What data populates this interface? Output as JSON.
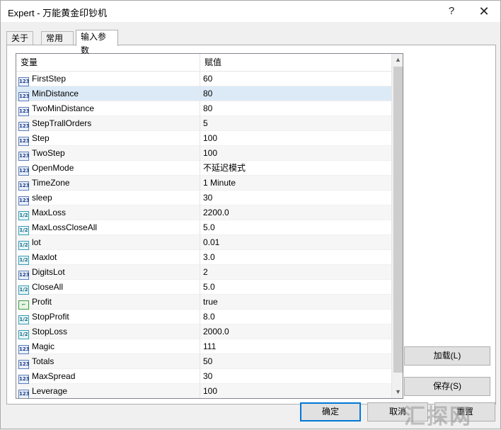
{
  "window": {
    "title": "Expert - 万能黄金印钞机",
    "help": "?",
    "close": "✕"
  },
  "tabs": [
    {
      "label": "关于"
    },
    {
      "label": "常用"
    },
    {
      "label": "输入参数"
    }
  ],
  "grid": {
    "col_variable": "变量",
    "col_value": "赋值",
    "rows": [
      {
        "name": "FirstStep",
        "value": "60",
        "type": "int"
      },
      {
        "name": "MinDistance",
        "value": "80",
        "type": "int"
      },
      {
        "name": "TwoMinDistance",
        "value": "80",
        "type": "int"
      },
      {
        "name": "StepTrallOrders",
        "value": "5",
        "type": "int"
      },
      {
        "name": "Step",
        "value": "100",
        "type": "int"
      },
      {
        "name": "TwoStep",
        "value": "100",
        "type": "int"
      },
      {
        "name": "OpenMode",
        "value": "不延迟模式",
        "type": "int"
      },
      {
        "name": "TimeZone",
        "value": "1 Minute",
        "type": "int"
      },
      {
        "name": "sleep",
        "value": "30",
        "type": "int"
      },
      {
        "name": "MaxLoss",
        "value": "2200.0",
        "type": "double"
      },
      {
        "name": "MaxLossCloseAll",
        "value": "5.0",
        "type": "double"
      },
      {
        "name": "lot",
        "value": "0.01",
        "type": "double"
      },
      {
        "name": "Maxlot",
        "value": "3.0",
        "type": "double"
      },
      {
        "name": "DigitsLot",
        "value": "2",
        "type": "int"
      },
      {
        "name": "CloseAll",
        "value": "5.0",
        "type": "double"
      },
      {
        "name": "Profit",
        "value": "true",
        "type": "bool"
      },
      {
        "name": "StopProfit",
        "value": "8.0",
        "type": "double"
      },
      {
        "name": "StopLoss",
        "value": "2000.0",
        "type": "double"
      },
      {
        "name": "Magic",
        "value": "111",
        "type": "int"
      },
      {
        "name": "Totals",
        "value": "50",
        "type": "int"
      },
      {
        "name": "MaxSpread",
        "value": "30",
        "type": "int"
      },
      {
        "name": "Leverage",
        "value": "100",
        "type": "int"
      }
    ],
    "selected_row": "MinDistance"
  },
  "icons": {
    "int": "123",
    "double": "1/2",
    "bool": "⌐"
  },
  "buttons": {
    "load": "加载(L)",
    "save": "保存(S)",
    "ok": "确定",
    "cancel": "取消",
    "reset": "重置"
  },
  "watermark": "汇探网"
}
